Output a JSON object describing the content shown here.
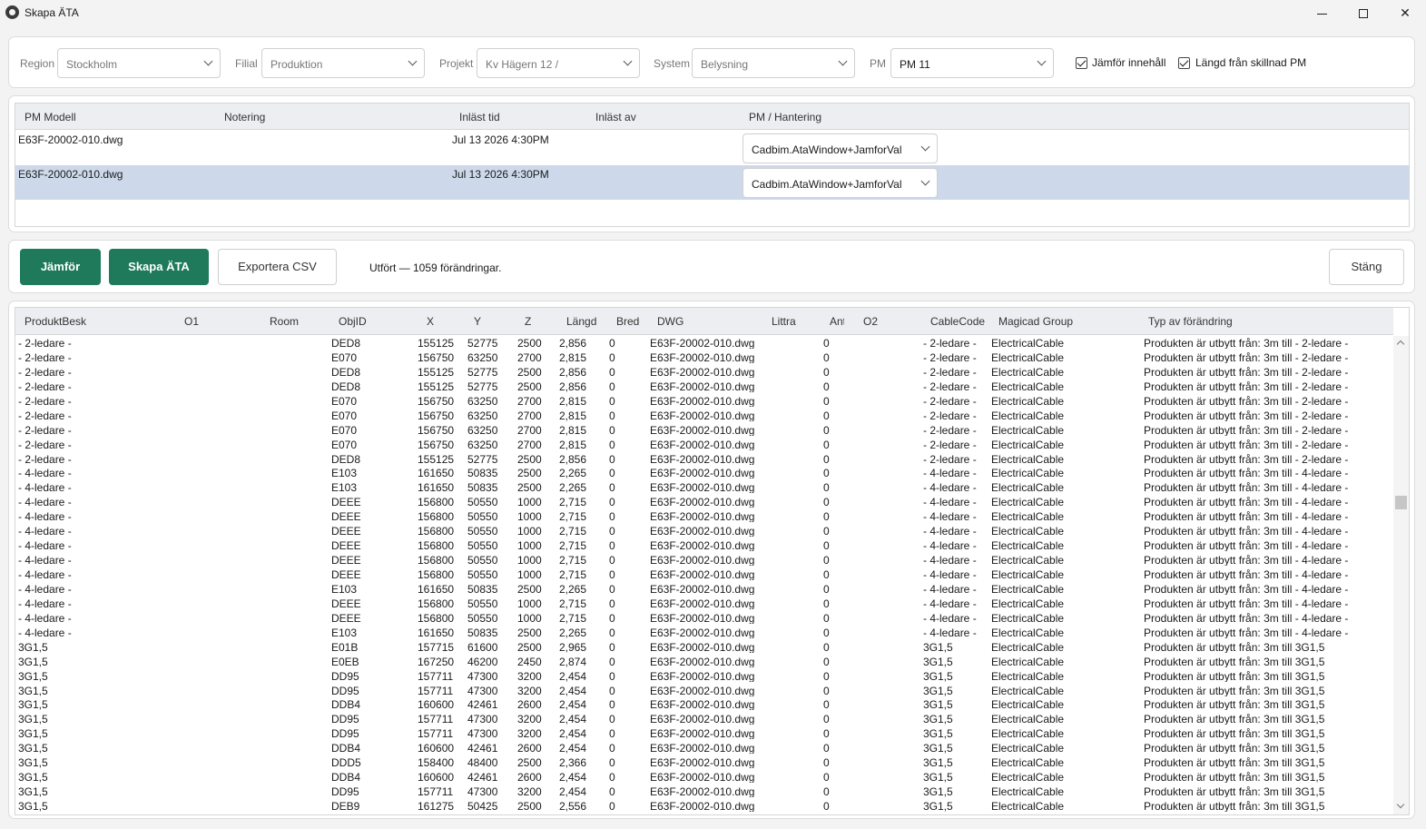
{
  "window": {
    "title": "Skapa ÄTA"
  },
  "filters": {
    "region": {
      "label": "Region",
      "value": "Stockholm"
    },
    "filial": {
      "label": "Filial",
      "value": "Produktion"
    },
    "projekt": {
      "label": "Projekt",
      "value": "Kv Hägern 12 /"
    },
    "system": {
      "label": "System",
      "value": "Belysning"
    },
    "pm": {
      "label": "PM",
      "value": "PM 11"
    },
    "compare_content": {
      "label": "Jämför innehåll",
      "checked": true
    },
    "length_diff": {
      "label": "Längd från skillnad PM",
      "checked": true
    }
  },
  "pm_table": {
    "headers": [
      "PM Modell",
      "Notering",
      "Inläst tid",
      "Inläst av",
      "PM / Hantering"
    ],
    "rows": [
      {
        "model": "E63F-20002-010.dwg",
        "note": "",
        "time": "Jul 13 2026  4:30PM",
        "by": "",
        "handling": "Cadbim.AtaWindow+JamforVal",
        "selected": false
      },
      {
        "model": "E63F-20002-010.dwg",
        "note": "",
        "time": "Jul 13 2026  4:30PM",
        "by": "",
        "handling": "Cadbim.AtaWindow+JamforVal",
        "selected": true
      }
    ]
  },
  "actions": {
    "compare": "Jämför",
    "create_ata": "Skapa ÄTA",
    "export_csv": "Exportera CSV",
    "status": "Utfört — 1059 förändringar.",
    "close": "Stäng"
  },
  "grid": {
    "headers": [
      "ProduktBesk",
      "O1",
      "Room",
      "ObjID",
      "X",
      "Y",
      "Z",
      "Längd",
      "Bredd",
      "DWG",
      "Littra",
      "Antal",
      "O2",
      "CableCode",
      "Magicad Group",
      "Typ av förändring"
    ],
    "rows": [
      [
        "- 2-ledare -",
        "",
        "",
        "DED8",
        "155125",
        "52775",
        "2500",
        "2,856",
        "0",
        "E63F-20002-010.dwg",
        "",
        "0",
        "",
        "- 2-ledare -",
        "ElectricalCable",
        "Produkten är utbytt från: 3m till - 2-ledare -"
      ],
      [
        "- 2-ledare -",
        "",
        "",
        "E070",
        "156750",
        "63250",
        "2700",
        "2,815",
        "0",
        "E63F-20002-010.dwg",
        "",
        "0",
        "",
        "- 2-ledare -",
        "ElectricalCable",
        "Produkten är utbytt från: 3m till - 2-ledare -"
      ],
      [
        "- 2-ledare -",
        "",
        "",
        "DED8",
        "155125",
        "52775",
        "2500",
        "2,856",
        "0",
        "E63F-20002-010.dwg",
        "",
        "0",
        "",
        "- 2-ledare -",
        "ElectricalCable",
        "Produkten är utbytt från: 3m till - 2-ledare -"
      ],
      [
        "- 2-ledare -",
        "",
        "",
        "DED8",
        "155125",
        "52775",
        "2500",
        "2,856",
        "0",
        "E63F-20002-010.dwg",
        "",
        "0",
        "",
        "- 2-ledare -",
        "ElectricalCable",
        "Produkten är utbytt från: 3m till - 2-ledare -"
      ],
      [
        "- 2-ledare -",
        "",
        "",
        "E070",
        "156750",
        "63250",
        "2700",
        "2,815",
        "0",
        "E63F-20002-010.dwg",
        "",
        "0",
        "",
        "- 2-ledare -",
        "ElectricalCable",
        "Produkten är utbytt från: 3m till - 2-ledare -"
      ],
      [
        "- 2-ledare -",
        "",
        "",
        "E070",
        "156750",
        "63250",
        "2700",
        "2,815",
        "0",
        "E63F-20002-010.dwg",
        "",
        "0",
        "",
        "- 2-ledare -",
        "ElectricalCable",
        "Produkten är utbytt från: 3m till - 2-ledare -"
      ],
      [
        "- 2-ledare -",
        "",
        "",
        "E070",
        "156750",
        "63250",
        "2700",
        "2,815",
        "0",
        "E63F-20002-010.dwg",
        "",
        "0",
        "",
        "- 2-ledare -",
        "ElectricalCable",
        "Produkten är utbytt från: 3m till - 2-ledare -"
      ],
      [
        "- 2-ledare -",
        "",
        "",
        "E070",
        "156750",
        "63250",
        "2700",
        "2,815",
        "0",
        "E63F-20002-010.dwg",
        "",
        "0",
        "",
        "- 2-ledare -",
        "ElectricalCable",
        "Produkten är utbytt från: 3m till - 2-ledare -"
      ],
      [
        "- 2-ledare -",
        "",
        "",
        "DED8",
        "155125",
        "52775",
        "2500",
        "2,856",
        "0",
        "E63F-20002-010.dwg",
        "",
        "0",
        "",
        "- 2-ledare -",
        "ElectricalCable",
        "Produkten är utbytt från: 3m till - 2-ledare -"
      ],
      [
        "- 4-ledare -",
        "",
        "",
        "E103",
        "161650",
        "50835",
        "2500",
        "2,265",
        "0",
        "E63F-20002-010.dwg",
        "",
        "0",
        "",
        "- 4-ledare -",
        "ElectricalCable",
        "Produkten är utbytt från: 3m till - 4-ledare -"
      ],
      [
        "- 4-ledare -",
        "",
        "",
        "E103",
        "161650",
        "50835",
        "2500",
        "2,265",
        "0",
        "E63F-20002-010.dwg",
        "",
        "0",
        "",
        "- 4-ledare -",
        "ElectricalCable",
        "Produkten är utbytt från: 3m till - 4-ledare -"
      ],
      [
        "- 4-ledare -",
        "",
        "",
        "DEEE",
        "156800",
        "50550",
        "1000",
        "2,715",
        "0",
        "E63F-20002-010.dwg",
        "",
        "0",
        "",
        "- 4-ledare -",
        "ElectricalCable",
        "Produkten är utbytt från: 3m till - 4-ledare -"
      ],
      [
        "- 4-ledare -",
        "",
        "",
        "DEEE",
        "156800",
        "50550",
        "1000",
        "2,715",
        "0",
        "E63F-20002-010.dwg",
        "",
        "0",
        "",
        "- 4-ledare -",
        "ElectricalCable",
        "Produkten är utbytt från: 3m till - 4-ledare -"
      ],
      [
        "- 4-ledare -",
        "",
        "",
        "DEEE",
        "156800",
        "50550",
        "1000",
        "2,715",
        "0",
        "E63F-20002-010.dwg",
        "",
        "0",
        "",
        "- 4-ledare -",
        "ElectricalCable",
        "Produkten är utbytt från: 3m till - 4-ledare -"
      ],
      [
        "- 4-ledare -",
        "",
        "",
        "DEEE",
        "156800",
        "50550",
        "1000",
        "2,715",
        "0",
        "E63F-20002-010.dwg",
        "",
        "0",
        "",
        "- 4-ledare -",
        "ElectricalCable",
        "Produkten är utbytt från: 3m till - 4-ledare -"
      ],
      [
        "- 4-ledare -",
        "",
        "",
        "DEEE",
        "156800",
        "50550",
        "1000",
        "2,715",
        "0",
        "E63F-20002-010.dwg",
        "",
        "0",
        "",
        "- 4-ledare -",
        "ElectricalCable",
        "Produkten är utbytt från: 3m till - 4-ledare -"
      ],
      [
        "- 4-ledare -",
        "",
        "",
        "DEEE",
        "156800",
        "50550",
        "1000",
        "2,715",
        "0",
        "E63F-20002-010.dwg",
        "",
        "0",
        "",
        "- 4-ledare -",
        "ElectricalCable",
        "Produkten är utbytt från: 3m till - 4-ledare -"
      ],
      [
        "- 4-ledare -",
        "",
        "",
        "E103",
        "161650",
        "50835",
        "2500",
        "2,265",
        "0",
        "E63F-20002-010.dwg",
        "",
        "0",
        "",
        "- 4-ledare -",
        "ElectricalCable",
        "Produkten är utbytt från: 3m till - 4-ledare -"
      ],
      [
        "- 4-ledare -",
        "",
        "",
        "DEEE",
        "156800",
        "50550",
        "1000",
        "2,715",
        "0",
        "E63F-20002-010.dwg",
        "",
        "0",
        "",
        "- 4-ledare -",
        "ElectricalCable",
        "Produkten är utbytt från: 3m till - 4-ledare -"
      ],
      [
        "- 4-ledare -",
        "",
        "",
        "DEEE",
        "156800",
        "50550",
        "1000",
        "2,715",
        "0",
        "E63F-20002-010.dwg",
        "",
        "0",
        "",
        "- 4-ledare -",
        "ElectricalCable",
        "Produkten är utbytt från: 3m till - 4-ledare -"
      ],
      [
        "- 4-ledare -",
        "",
        "",
        "E103",
        "161650",
        "50835",
        "2500",
        "2,265",
        "0",
        "E63F-20002-010.dwg",
        "",
        "0",
        "",
        "- 4-ledare -",
        "ElectricalCable",
        "Produkten är utbytt från: 3m till - 4-ledare -"
      ],
      [
        "3G1,5",
        "",
        "",
        "E01B",
        "157715",
        "61600",
        "2500",
        "2,965",
        "0",
        "E63F-20002-010.dwg",
        "",
        "0",
        "",
        "3G1,5",
        "ElectricalCable",
        "Produkten är utbytt från: 3m till 3G1,5"
      ],
      [
        "3G1,5",
        "",
        "",
        "E0EB",
        "167250",
        "46200",
        "2450",
        "2,874",
        "0",
        "E63F-20002-010.dwg",
        "",
        "0",
        "",
        "3G1,5",
        "ElectricalCable",
        "Produkten är utbytt från: 3m till 3G1,5"
      ],
      [
        "3G1,5",
        "",
        "",
        "DD95",
        "157711",
        "47300",
        "3200",
        "2,454",
        "0",
        "E63F-20002-010.dwg",
        "",
        "0",
        "",
        "3G1,5",
        "ElectricalCable",
        "Produkten är utbytt från: 3m till 3G1,5"
      ],
      [
        "3G1,5",
        "",
        "",
        "DD95",
        "157711",
        "47300",
        "3200",
        "2,454",
        "0",
        "E63F-20002-010.dwg",
        "",
        "0",
        "",
        "3G1,5",
        "ElectricalCable",
        "Produkten är utbytt från: 3m till 3G1,5"
      ],
      [
        "3G1,5",
        "",
        "",
        "DDB4",
        "160600",
        "42461",
        "2600",
        "2,454",
        "0",
        "E63F-20002-010.dwg",
        "",
        "0",
        "",
        "3G1,5",
        "ElectricalCable",
        "Produkten är utbytt från: 3m till 3G1,5"
      ],
      [
        "3G1,5",
        "",
        "",
        "DD95",
        "157711",
        "47300",
        "3200",
        "2,454",
        "0",
        "E63F-20002-010.dwg",
        "",
        "0",
        "",
        "3G1,5",
        "ElectricalCable",
        "Produkten är utbytt från: 3m till 3G1,5"
      ],
      [
        "3G1,5",
        "",
        "",
        "DD95",
        "157711",
        "47300",
        "3200",
        "2,454",
        "0",
        "E63F-20002-010.dwg",
        "",
        "0",
        "",
        "3G1,5",
        "ElectricalCable",
        "Produkten är utbytt från: 3m till 3G1,5"
      ],
      [
        "3G1,5",
        "",
        "",
        "DDB4",
        "160600",
        "42461",
        "2600",
        "2,454",
        "0",
        "E63F-20002-010.dwg",
        "",
        "0",
        "",
        "3G1,5",
        "ElectricalCable",
        "Produkten är utbytt från: 3m till 3G1,5"
      ],
      [
        "3G1,5",
        "",
        "",
        "DDD5",
        "158400",
        "48400",
        "2500",
        "2,366",
        "0",
        "E63F-20002-010.dwg",
        "",
        "0",
        "",
        "3G1,5",
        "ElectricalCable",
        "Produkten är utbytt från: 3m till 3G1,5"
      ],
      [
        "3G1,5",
        "",
        "",
        "DDB4",
        "160600",
        "42461",
        "2600",
        "2,454",
        "0",
        "E63F-20002-010.dwg",
        "",
        "0",
        "",
        "3G1,5",
        "ElectricalCable",
        "Produkten är utbytt från: 3m till 3G1,5"
      ],
      [
        "3G1,5",
        "",
        "",
        "DD95",
        "157711",
        "47300",
        "3200",
        "2,454",
        "0",
        "E63F-20002-010.dwg",
        "",
        "0",
        "",
        "3G1,5",
        "ElectricalCable",
        "Produkten är utbytt från: 3m till 3G1,5"
      ],
      [
        "3G1,5",
        "",
        "",
        "DEB9",
        "161275",
        "50425",
        "2500",
        "2,556",
        "0",
        "E63F-20002-010.dwg",
        "",
        "0",
        "",
        "3G1,5",
        "ElectricalCable",
        "Produkten är utbytt från: 3m till 3G1,5"
      ]
    ]
  },
  "colors": {
    "accent": "#1e7a5a",
    "selected_row": "#cdd9ea",
    "header_bg": "#eceef1"
  }
}
